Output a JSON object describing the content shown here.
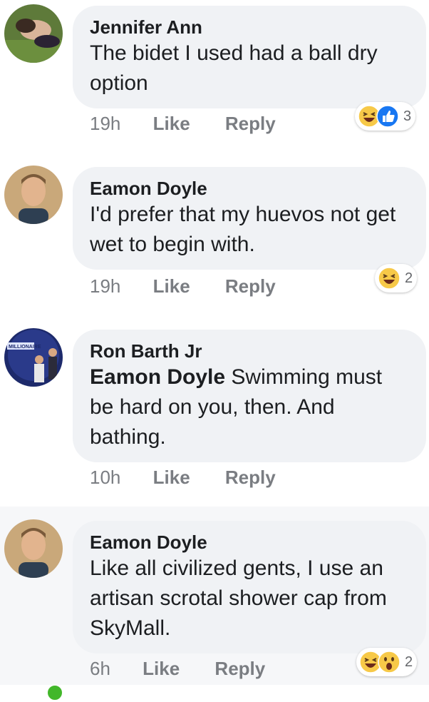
{
  "comments": [
    {
      "author": "Jennifer Ann",
      "text": "The bidet I used had a ball dry option",
      "mention": "",
      "time": "19h",
      "like_label": "Like",
      "reply_label": "Reply",
      "reactions": [
        "haha-icon",
        "like-icon"
      ],
      "reaction_count": "3"
    },
    {
      "author": "Eamon Doyle",
      "text": "I'd prefer that my huevos not get wet to begin with.",
      "mention": "",
      "time": "19h",
      "like_label": "Like",
      "reply_label": "Reply",
      "reactions": [
        "haha-icon"
      ],
      "reaction_count": "2"
    },
    {
      "author": "Ron Barth Jr",
      "mention": "Eamon Doyle",
      "text": " Swimming must be hard on you, then. And bathing.",
      "time": "10h",
      "like_label": "Like",
      "reply_label": "Reply",
      "online": true,
      "avatar_sign": "MILLIONAIRE"
    },
    {
      "author": "Eamon Doyle",
      "text": "Like all civilized gents, I use an artisan scrotal shower cap from SkyMall.",
      "mention": "",
      "time": "6h",
      "like_label": "Like",
      "reply_label": "Reply",
      "reactions": [
        "haha-icon",
        "wow-icon"
      ],
      "reaction_count": "2"
    }
  ],
  "colors": {
    "bubble": "#f0f2f5",
    "meta_text": "#65676b",
    "like_blue": "#1877f2",
    "emoji_yellow": "#f7c948",
    "online_green": "#42b72a"
  }
}
